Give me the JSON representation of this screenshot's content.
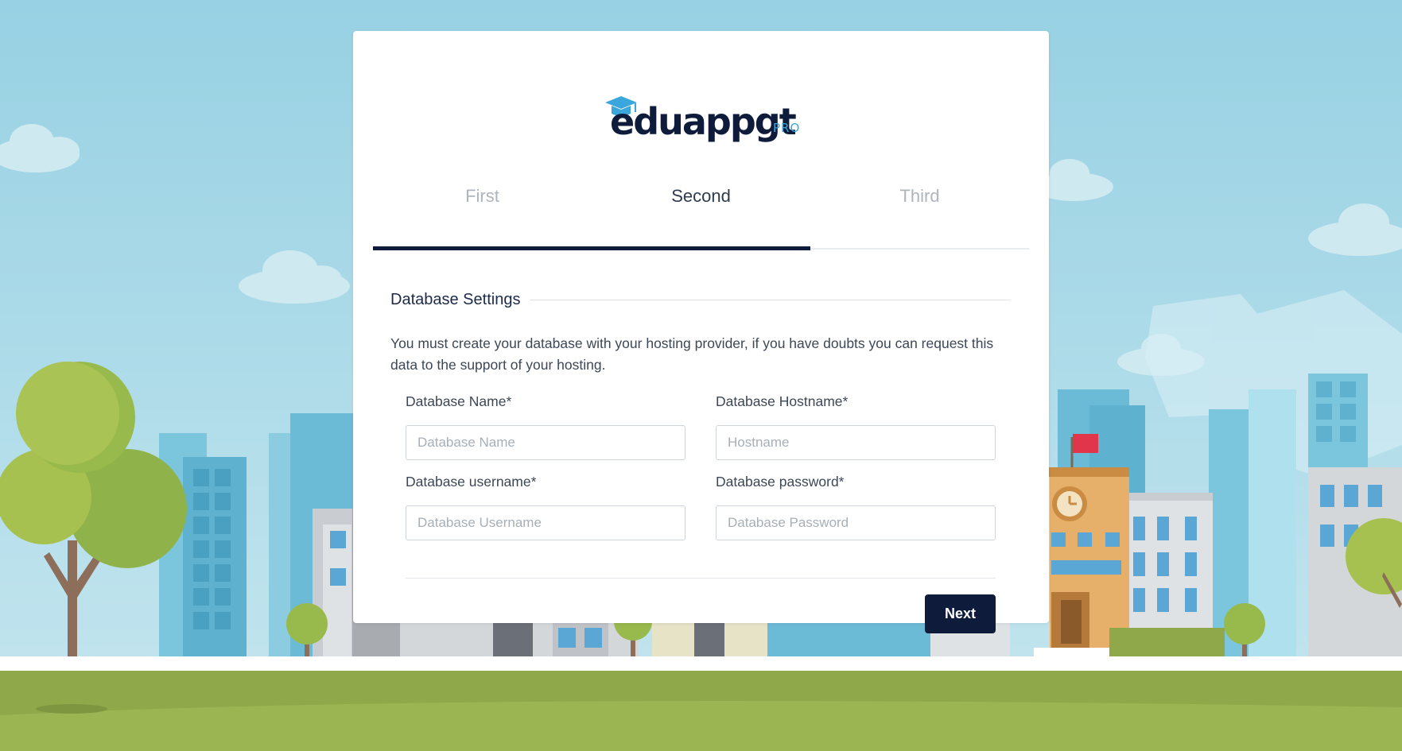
{
  "logo": {
    "word": "eduappgt",
    "badge": "PRO"
  },
  "tabs": [
    {
      "label": "First",
      "active": false
    },
    {
      "label": "Second",
      "active": true
    },
    {
      "label": "Third",
      "active": false
    }
  ],
  "section": {
    "title": "Database Settings",
    "description": "You must create your database with your hosting provider, if you have doubts you can request this data to the support of your hosting."
  },
  "fields": {
    "db_name": {
      "label": "Database Name*",
      "placeholder": "Database Name",
      "value": ""
    },
    "db_host": {
      "label": "Database Hostname*",
      "placeholder": "Hostname",
      "value": ""
    },
    "db_user": {
      "label": "Database username*",
      "placeholder": "Database Username",
      "value": ""
    },
    "db_pass": {
      "label": "Database password*",
      "placeholder": "Database Password",
      "value": ""
    }
  },
  "actions": {
    "next_label": "Next"
  },
  "colors": {
    "brand_navy": "#0e1b3a",
    "brand_blue": "#3aa6dc"
  }
}
